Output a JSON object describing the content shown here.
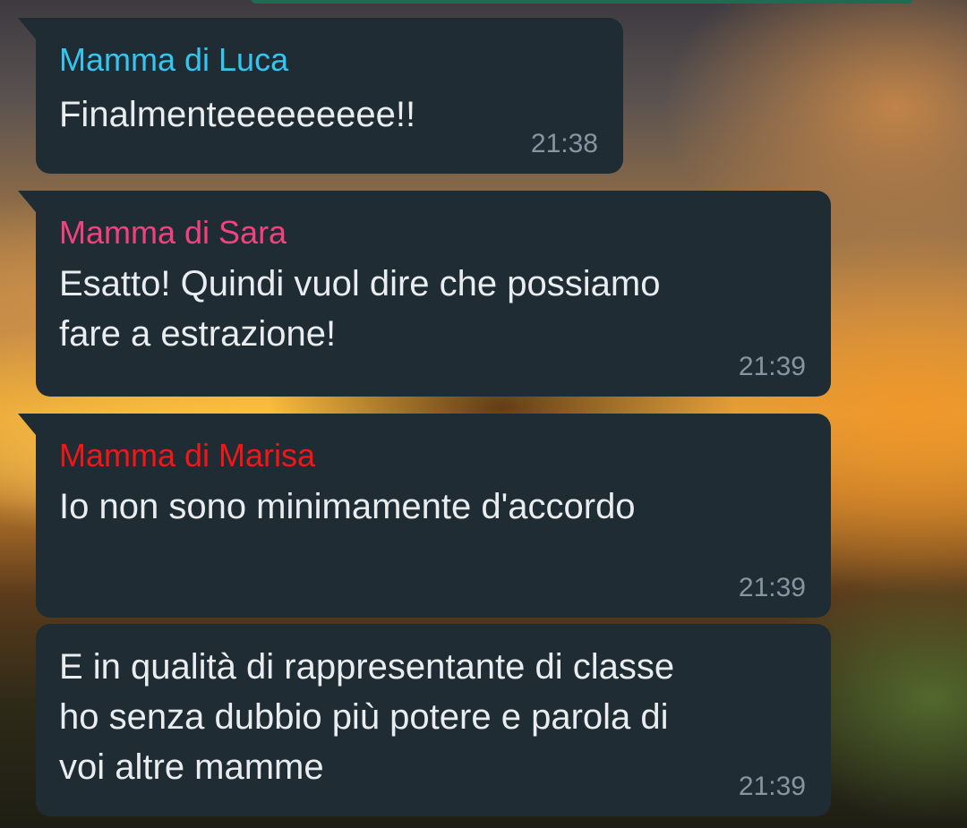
{
  "colors": {
    "bubble_bg": "#1f2c34",
    "text": "#e9edef",
    "time": "#8696a0"
  },
  "messages": [
    {
      "sender": "Mamma di Luca",
      "sender_color": "#35c5f0",
      "text": "Finalmenteeeeeeeee!!",
      "time": "21:38"
    },
    {
      "sender": "Mamma di Sara",
      "sender_color": "#f2427e",
      "text": "Esatto! Quindi vuol dire che possiamo\nfare a estrazione!",
      "time": "21:39"
    },
    {
      "sender": "Mamma di Marisa",
      "sender_color": "#f21616",
      "text": "Io non sono minimamente d'accordo",
      "time": "21:39"
    },
    {
      "text": "E in qualità di rappresentante di classe\nho senza dubbio più potere e parola di\nvoi altre mamme",
      "time": "21:39"
    }
  ]
}
